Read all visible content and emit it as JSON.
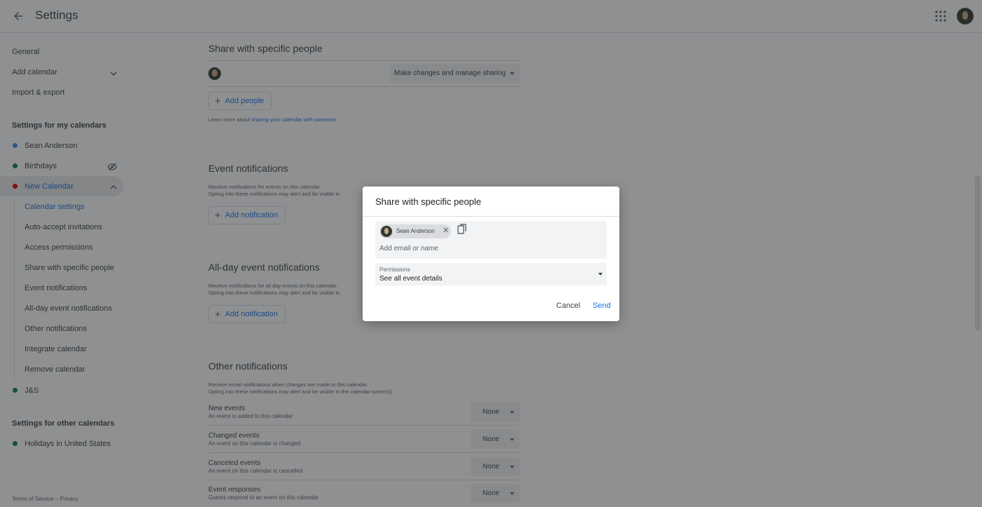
{
  "header": {
    "title": "Settings"
  },
  "sidebar": {
    "general": "General",
    "add_calendar": "Add calendar",
    "import_export": "Import & export",
    "my_calendars_heading": "Settings for my calendars",
    "my_calendars": [
      {
        "label": "Sean Anderson",
        "color": "#4285f4"
      },
      {
        "label": "Birthdays",
        "color": "#0b8043"
      },
      {
        "label": "New Calendar",
        "color": "#d50000"
      }
    ],
    "sub_items": [
      "Calendar settings",
      "Auto-accept invitations",
      "Access permissions",
      "Share with specific people",
      "Event notifications",
      "All-day event notifications",
      "Other notifications",
      "Integrate calendar",
      "Remove calendar"
    ],
    "js_calendar": {
      "label": "J&S",
      "color": "#0b8043"
    },
    "other_calendars_heading": "Settings for other calendars",
    "other_calendars": [
      {
        "label": "Holidays in United States",
        "color": "#0b8043"
      }
    ],
    "footer": {
      "terms": "Terms of Service",
      "sep": "–",
      "privacy": "Privacy"
    }
  },
  "main": {
    "share": {
      "title": "Share with specific people",
      "permission_value": "Make changes and manage sharing",
      "add_people": "Add people",
      "learn_prefix": "Learn more about ",
      "learn_link": "sharing your calendar with someone"
    },
    "event_notifications": {
      "title": "Event notifications",
      "desc1": "Receive notifications for events on this calendar.",
      "desc2": "Opting into these notifications may alert and be visible to",
      "add_button": "Add notification"
    },
    "allday_notifications": {
      "title": "All-day event notifications",
      "desc1": "Receive notifications for all day events on this calendar.",
      "desc2": "Opting into these notifications may alert and be visible to",
      "add_button": "Add notification"
    },
    "other_notifications": {
      "title": "Other notifications",
      "desc1": "Receive email notifications when changes are made to this calendar.",
      "desc2": "Opting into these notifications may alert and be visible to the calendar owner(s)",
      "rows": [
        {
          "label": "New events",
          "desc": "An event is added to this calendar",
          "value": "None"
        },
        {
          "label": "Changed events",
          "desc": "An event on this calendar is changed",
          "value": "None"
        },
        {
          "label": "Canceled events",
          "desc": "An event on this calendar is cancelled",
          "value": "None"
        },
        {
          "label": "Event responses",
          "desc": "Guests respond to an event on this calendar",
          "value": "None"
        }
      ]
    }
  },
  "dialog": {
    "title": "Share with specific people",
    "chip_name": "Sean Anderson",
    "input_placeholder": "Add email or name",
    "permissions_label": "Permissions",
    "permissions_value": "See all event details",
    "cancel": "Cancel",
    "send": "Send",
    "accent": "#1a73e8"
  }
}
